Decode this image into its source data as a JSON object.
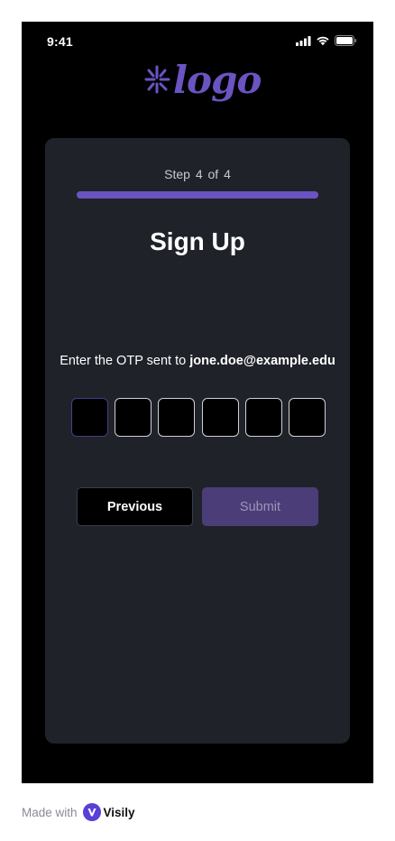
{
  "status_bar": {
    "time": "9:41"
  },
  "logo": {
    "text": "logo",
    "color": "#6b53c2"
  },
  "card": {
    "step": {
      "prefix": "Step",
      "current": "4",
      "of": "of",
      "total": "4",
      "progress": 1.0
    },
    "title": "Sign Up",
    "otp": {
      "prompt": "Enter the OTP sent to",
      "email": "jone.doe@example.edu",
      "digits": [
        "",
        "",
        "",
        "",
        "",
        ""
      ],
      "active_index": 0
    },
    "buttons": {
      "previous": "Previous",
      "submit": "Submit"
    }
  },
  "footer": {
    "made_with": "Made with",
    "brand": "Visily"
  },
  "colors": {
    "accent": "#6b53c2",
    "card_bg": "#20222a",
    "submit_bg": "#4b3e78"
  }
}
